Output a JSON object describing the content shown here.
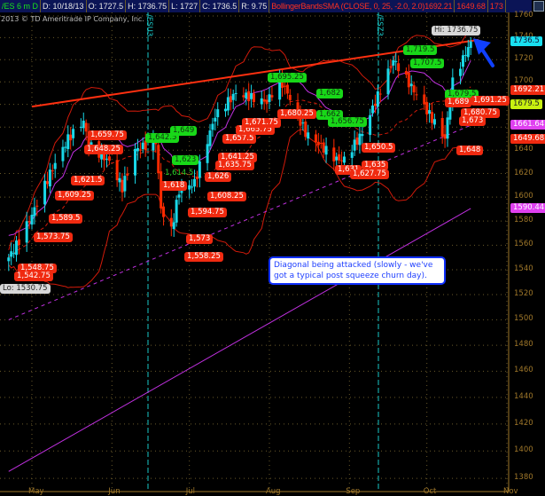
{
  "header": {
    "symbol": "/ES 6 m D",
    "date": "D: 10/18/13",
    "open": "O: 1727.5",
    "high": "H: 1736.75",
    "low": "L: 1727",
    "close": "C: 1736.5",
    "range": "R: 9.75",
    "study": "BollingerBandsSMA (CLOSE, 0, 25, -2.0, 2.0)1692.21",
    "lower": "1649.68",
    "extra": "173"
  },
  "copyright": "2013 © TD Ameritrade IP Company, Inc.",
  "rolls": [
    "/ESU3",
    "/ESZ3"
  ],
  "note": "Diagonal being attacked (slowly - we've got a typical post squeeze churn day).",
  "colors": {
    "up": "#19d8e8",
    "down": "#ff2a00",
    "band": "#d01a0a",
    "ma": "#c030e0",
    "trend": "#ff3010",
    "grid": "#6a5a2a"
  },
  "chart_data": {
    "type": "candlestick",
    "title": "/ES 6 m D",
    "y_scale": "log",
    "ylim": [
      1370,
      1765
    ],
    "y_ticks": [
      1760,
      1740,
      1720,
      1700,
      1680,
      1660,
      1640,
      1620,
      1600,
      1580,
      1560,
      1540,
      1520,
      1500,
      1480,
      1460,
      1440,
      1420,
      1400,
      1380
    ],
    "x_ticks": [
      {
        "label": "May",
        "date": "2013-05-01"
      },
      {
        "label": "Jun",
        "date": "2013-06-01"
      },
      {
        "label": "Jul",
        "date": "2013-07-01"
      },
      {
        "label": "Aug",
        "date": "2013-08-01"
      },
      {
        "label": "Sep",
        "date": "2013-09-01"
      },
      {
        "label": "Oct",
        "date": "2013-10-01"
      },
      {
        "label": "Nov",
        "date": "2013-11-01"
      }
    ],
    "date_range": [
      "2013-04-22",
      "2013-10-18"
    ],
    "close_keypoints": [
      [
        "2013-04-22",
        1550
      ],
      [
        "2013-04-25",
        1560
      ],
      [
        "2013-05-01",
        1585
      ],
      [
        "2013-05-08",
        1620
      ],
      [
        "2013-05-15",
        1650
      ],
      [
        "2013-05-21",
        1665
      ],
      [
        "2013-05-23",
        1645
      ],
      [
        "2013-05-31",
        1630
      ],
      [
        "2013-06-05",
        1608
      ],
      [
        "2013-06-10",
        1640
      ],
      [
        "2013-06-18",
        1648
      ],
      [
        "2013-06-20",
        1590
      ],
      [
        "2013-06-24",
        1572
      ],
      [
        "2013-06-27",
        1605
      ],
      [
        "2013-07-03",
        1612
      ],
      [
        "2013-07-11",
        1670
      ],
      [
        "2013-07-19",
        1690
      ],
      [
        "2013-07-31",
        1682
      ],
      [
        "2013-08-05",
        1702
      ],
      [
        "2013-08-08",
        1690
      ],
      [
        "2013-08-15",
        1655
      ],
      [
        "2013-08-27",
        1632
      ],
      [
        "2013-08-30",
        1632
      ],
      [
        "2013-09-06",
        1655
      ],
      [
        "2013-09-18",
        1720
      ],
      [
        "2013-09-26",
        1692
      ],
      [
        "2013-10-08",
        1650
      ],
      [
        "2013-10-11",
        1700
      ],
      [
        "2013-10-18",
        1736.5
      ]
    ],
    "long_ma": [
      [
        "2013-04-22",
        1385
      ],
      [
        "2013-10-18",
        1590.44
      ]
    ],
    "dashed_ma": [
      [
        "2013-04-22",
        1500
      ],
      [
        "2013-10-18",
        1661.64
      ]
    ],
    "trendline": [
      [
        "2013-05-01",
        1678
      ],
      [
        "2013-10-21",
        1738
      ]
    ],
    "annotations": [
      {
        "text": "1,659.75",
        "kind": "red"
      },
      {
        "text": "1,648.25",
        "kind": "red"
      },
      {
        "text": "1,621.5",
        "kind": "red"
      },
      {
        "text": "1,609.25",
        "kind": "red"
      },
      {
        "text": "1,589.5",
        "kind": "red"
      },
      {
        "text": "1,573.75",
        "kind": "red"
      },
      {
        "text": "1,548.75",
        "kind": "red"
      },
      {
        "text": "1,542.75",
        "kind": "red"
      },
      {
        "text": "Lo: 1530.75",
        "kind": "grey"
      },
      {
        "text": "1,642.5",
        "kind": "green"
      },
      {
        "text": "1,649",
        "kind": "green"
      },
      {
        "text": "1,623",
        "kind": "green"
      },
      {
        "text": "1,614.5",
        "kind": "gtext"
      },
      {
        "text": "1,618",
        "kind": "red"
      },
      {
        "text": "1,626",
        "kind": "red"
      },
      {
        "text": "1,608.25",
        "kind": "red"
      },
      {
        "text": "1,594.75",
        "kind": "red"
      },
      {
        "text": "1,573",
        "kind": "red"
      },
      {
        "text": "1,558.25",
        "kind": "red"
      },
      {
        "text": "1,641.25",
        "kind": "red"
      },
      {
        "text": "1,635.75",
        "kind": "red"
      },
      {
        "text": "1,657.5",
        "kind": "red"
      },
      {
        "text": "1,665.75",
        "kind": "red"
      },
      {
        "text": "1,671.75",
        "kind": "red"
      },
      {
        "text": "1,695.25",
        "kind": "green"
      },
      {
        "text": "1,680.25",
        "kind": "red"
      },
      {
        "text": "1,682",
        "kind": "green"
      },
      {
        "text": "1,662",
        "kind": "green"
      },
      {
        "text": "1,656.75",
        "kind": "green"
      },
      {
        "text": "1,650.5",
        "kind": "red"
      },
      {
        "text": "1,631",
        "kind": "red"
      },
      {
        "text": "1,635",
        "kind": "red"
      },
      {
        "text": "1,627.75",
        "kind": "red"
      },
      {
        "text": "1,719.5",
        "kind": "green"
      },
      {
        "text": "1,707.5",
        "kind": "green"
      },
      {
        "text": "1,679.5",
        "kind": "green"
      },
      {
        "text": "1,689",
        "kind": "red"
      },
      {
        "text": "1,691.25",
        "kind": "red"
      },
      {
        "text": "1,680.75",
        "kind": "red"
      },
      {
        "text": "1,673",
        "kind": "red"
      },
      {
        "text": "1,648",
        "kind": "red"
      },
      {
        "text": "Hi: 1736.75",
        "kind": "grey"
      }
    ],
    "axis_badges": [
      {
        "value": "1736.5",
        "price": 1736.5,
        "bg": "#19e0f0",
        "fg": "#113"
      },
      {
        "value": "1692.21",
        "price": 1692.21,
        "bg": "#f02a10",
        "fg": "#fff"
      },
      {
        "value": "1679.5",
        "price": 1679.5,
        "bg": "#c8f010",
        "fg": "#222"
      },
      {
        "value": "1661.64",
        "price": 1661.64,
        "bg": "#e040f0",
        "fg": "#fff"
      },
      {
        "value": "1649.68",
        "price": 1649.68,
        "bg": "#f02a10",
        "fg": "#fff"
      },
      {
        "value": "1590.44",
        "price": 1590.44,
        "bg": "#e040f0",
        "fg": "#fff"
      }
    ]
  }
}
